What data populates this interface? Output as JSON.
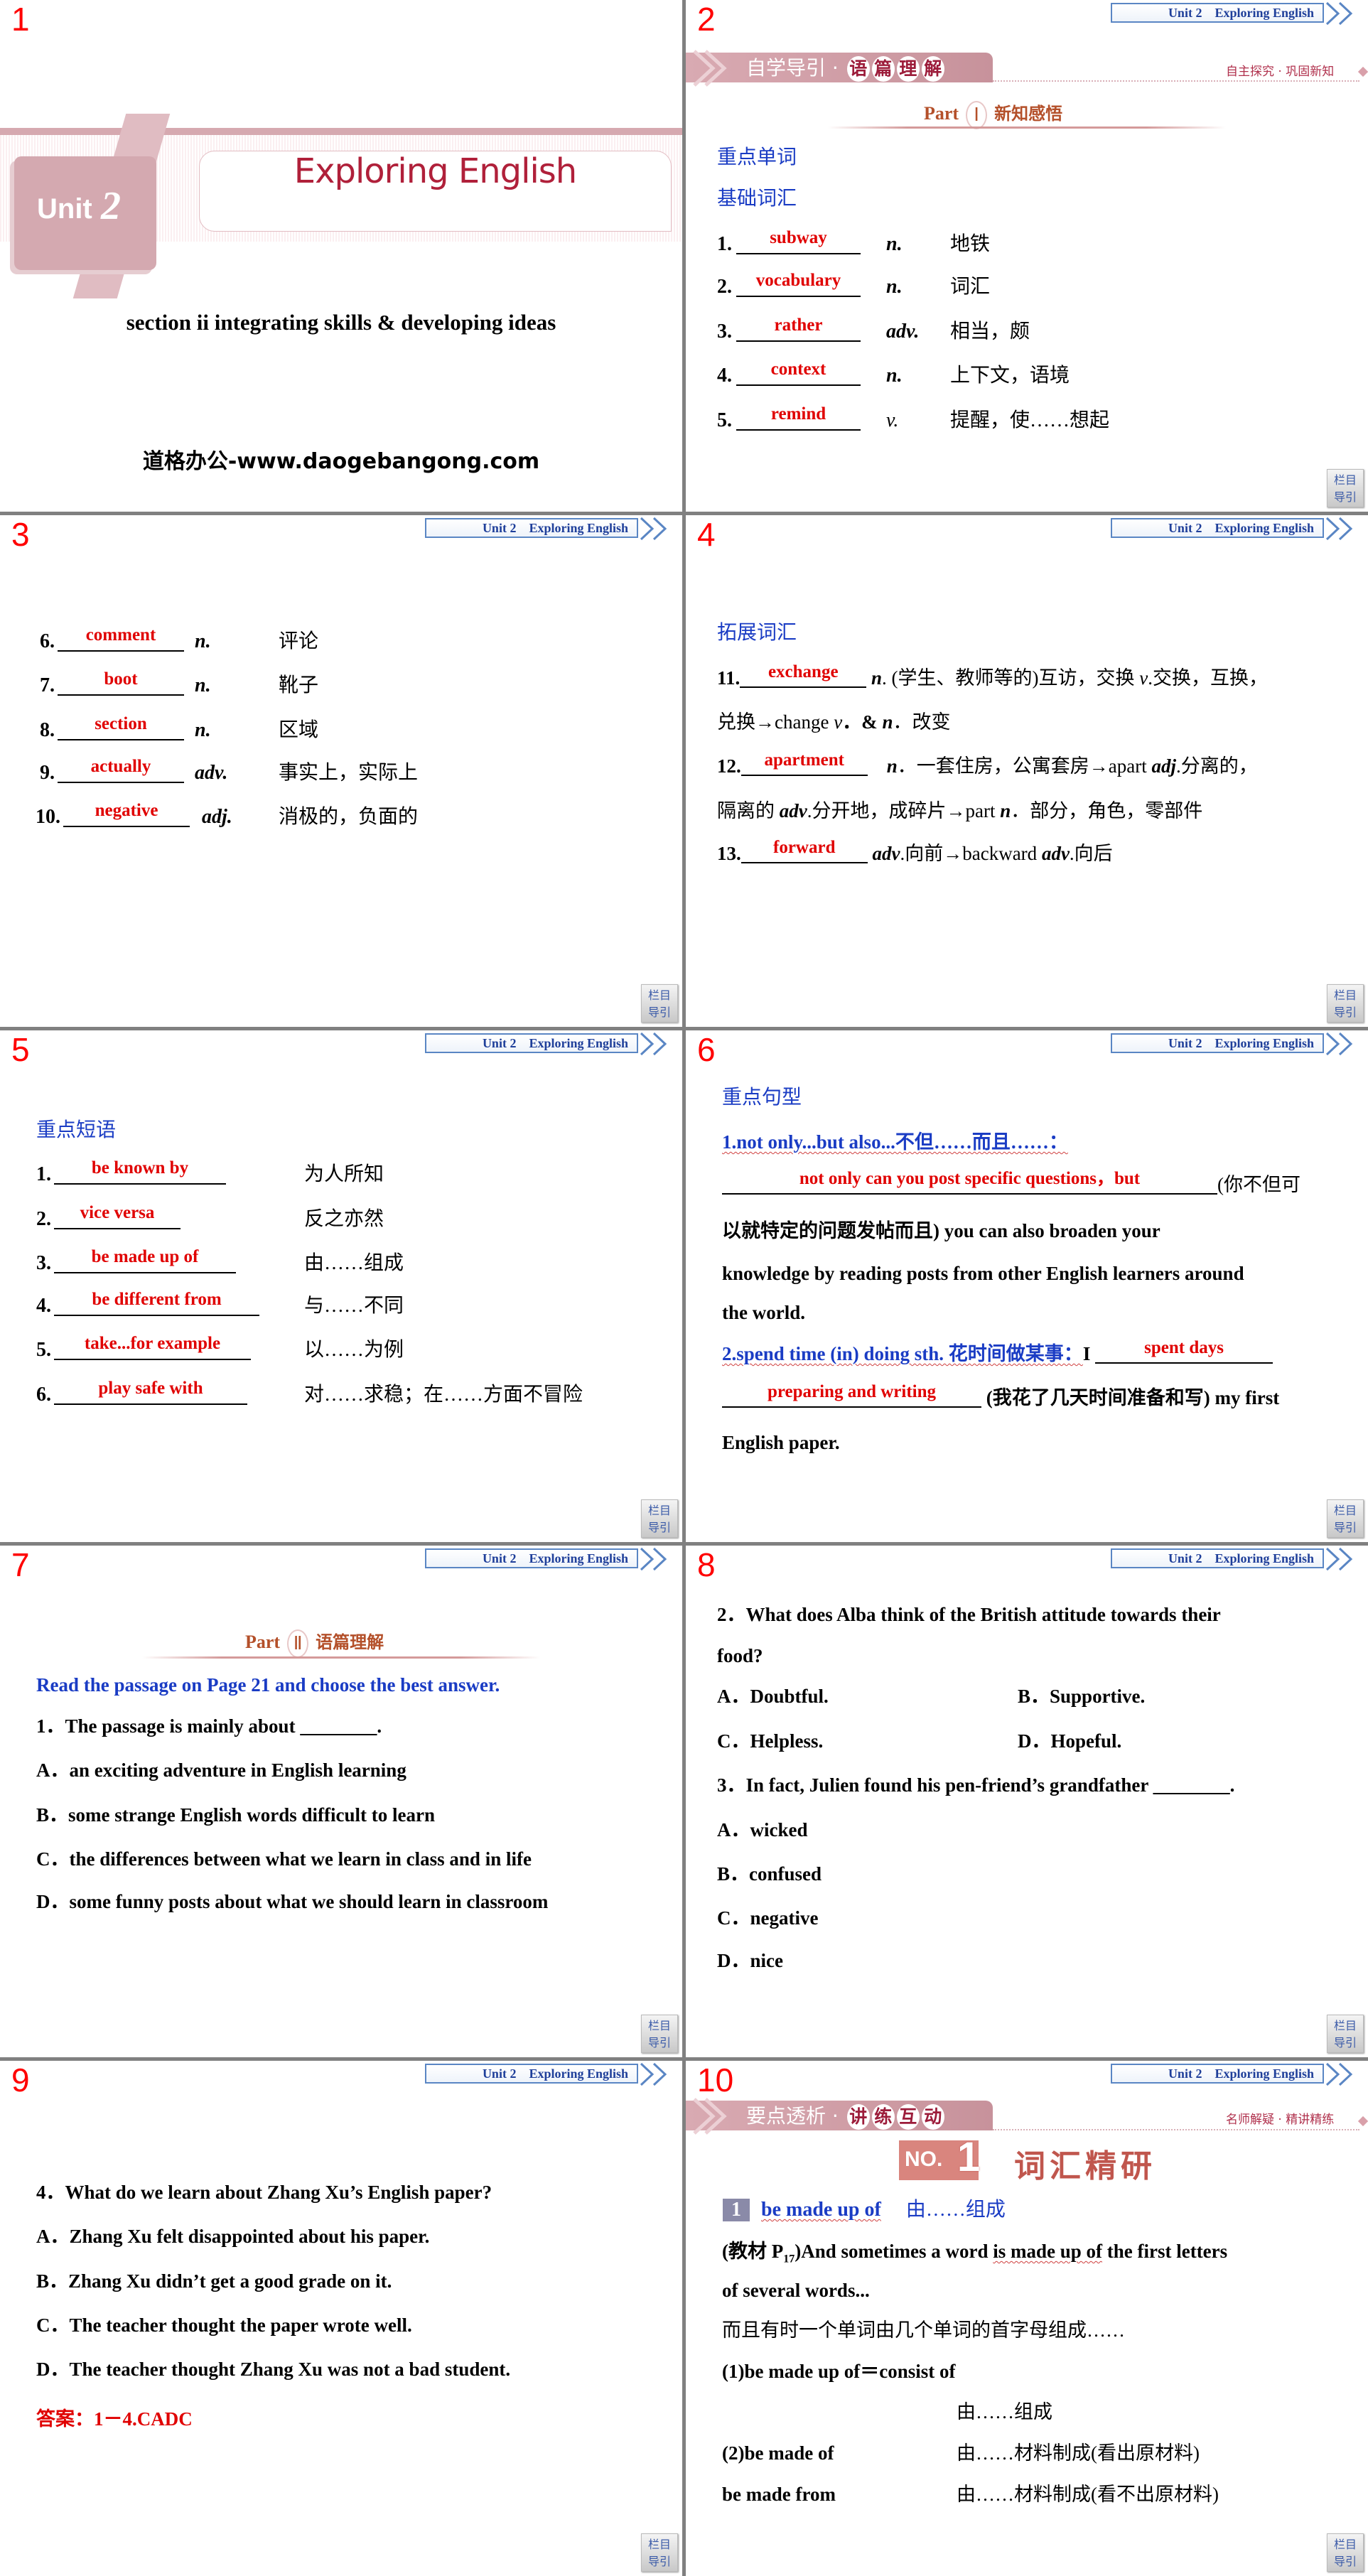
{
  "common": {
    "header": "Unit 2　Exploring English",
    "nav_line1": "栏目",
    "nav_line2": "导引"
  },
  "s1": {
    "number": "1",
    "unit_label": "Unit",
    "unit_num": "2",
    "title": "Exploring English",
    "subtitle": "section ii integrating skills & developing ideas",
    "website": "道格办公-www.daogebangong.com"
  },
  "s2": {
    "number": "2",
    "band_left": "自学导引 ·",
    "band_chars": [
      "语",
      "篇",
      "理",
      "解"
    ],
    "band_tag": "自主探究 · 巩固新知",
    "part_label": "Part",
    "part_num": "Ⅰ",
    "part_title": "新知感悟",
    "heading1": "重点单词",
    "heading2": "基础词汇",
    "items": [
      {
        "n": "1.",
        "ans": "subway",
        "pos": "n.",
        "cn": "地铁"
      },
      {
        "n": "2.",
        "ans": "vocabulary",
        "pos": "n.",
        "cn": "词汇"
      },
      {
        "n": "3.",
        "ans": "rather",
        "pos": "adv.",
        "cn": "相当，颇"
      },
      {
        "n": "4.",
        "ans": "context",
        "pos": "n.",
        "cn": "上下文，语境"
      },
      {
        "n": "5.",
        "ans": "remind",
        "pos": "v.",
        "cn": "提醒，使……想起"
      }
    ]
  },
  "s3": {
    "number": "3",
    "items": [
      {
        "n": "6.",
        "ans": "comment",
        "pos": "n.",
        "cn": "评论"
      },
      {
        "n": "7.",
        "ans": "boot",
        "pos": "n.",
        "cn": "靴子"
      },
      {
        "n": "8.",
        "ans": "section",
        "pos": "n.",
        "cn": "区域"
      },
      {
        "n": "9.",
        "ans": "actually",
        "pos": "adv.",
        "cn": "事实上，实际上"
      },
      {
        "n": "10.",
        "ans": "negative",
        "pos": "adj.",
        "cn": "消极的，负面的"
      }
    ]
  },
  "s4": {
    "number": "4",
    "heading": "拓展词汇",
    "i11": {
      "n": "11.",
      "ans": "exchange",
      "a": "n",
      "b": ". (学生、教师等的)互访，交换 ",
      "c": "v",
      "d": ".交换，互换，",
      "l2a": "兑换→change ",
      "l2b": "v",
      "l2c": "．& ",
      "l2d": "n",
      "l2e": "．改变"
    },
    "i12": {
      "n": "12.",
      "ans": "apartment",
      "a": "n",
      "b": "．一套住房，公寓套房→apart ",
      "c": "adj",
      "d": ".分离的，",
      "l2a": "隔离的 ",
      "l2b": "adv",
      "l2c": ".分开地，成碎片→part ",
      "l2d": "n",
      "l2e": "．部分，角色，零部件"
    },
    "i13": {
      "n": "13.",
      "ans": "forward",
      "a": "adv",
      "b": ".向前→backward ",
      "c": "adv",
      "d": ".向后"
    }
  },
  "s5": {
    "number": "5",
    "heading": "重点短语",
    "items": [
      {
        "n": "1.",
        "ans": "be known by",
        "cn": "为人所知"
      },
      {
        "n": "2.",
        "ans": "vice versa",
        "cn": "反之亦然"
      },
      {
        "n": "3.",
        "ans": "be made up of",
        "cn": "由……组成"
      },
      {
        "n": "4.",
        "ans": "be different from",
        "cn": "与……不同"
      },
      {
        "n": "5.",
        "ans": "take...for example",
        "cn": "以……为例"
      },
      {
        "n": "6.",
        "ans": "play safe with",
        "cn": "对……求稳；在……方面不冒险"
      }
    ]
  },
  "s6": {
    "number": "6",
    "heading": "重点句型",
    "p1_title": "1.not only...but also...不但……而且……：",
    "p1_ans": "not only can you post specific questions，but",
    "p1_a": "(你不但可",
    "p1_b": "以就特定的问题发帖而且) you can also broaden your",
    "p1_c": "knowledge by reading posts from other English learners around",
    "p1_d": "the world.",
    "p2_title": "2.spend time (in) doing sth. 花时间做某事：",
    "p2_i": "I ",
    "p2_ans1": "spent days",
    "p2_ans2": "preparing and writing",
    "p2_a": "(我花了几天时间准备和写) my first",
    "p2_b": "English paper."
  },
  "s7": {
    "number": "7",
    "part_label": "Part",
    "part_num": "Ⅱ",
    "part_title": "语篇理解",
    "instruction": "Read the passage on Page 21 and choose the best answer.",
    "question": "1．The passage is mainly about ________.",
    "options": [
      "A．an exciting adventure in English learning",
      "B．some strange English words difficult to learn",
      "C．the differences between what we learn in class and in life",
      "D．some funny posts about what we should learn in classroom"
    ]
  },
  "s8": {
    "number": "8",
    "q2": "2．What does Alba think of the British attitude towards their",
    "q2b": "food?",
    "q2_options": [
      "A．Doubtful.",
      "B．Supportive.",
      "C．Helpless.",
      "D．Hopeful."
    ],
    "q3": "3．In fact, Julien found his pen-friend’s grandfather ________.",
    "q3_options": [
      "A．wicked",
      "B．confused",
      "C．negative",
      "D．nice"
    ]
  },
  "s9": {
    "number": "9",
    "q4": "4．What do we learn about Zhang Xu’s English paper?",
    "options": [
      "A．Zhang Xu felt disappointed about his paper.",
      "B．Zhang Xu didn’t get a good grade on it.",
      "C．The teacher thought the paper wrote well.",
      "D．The teacher thought Zhang Xu was not a bad student."
    ],
    "answer": "答案：1－4.CADC"
  },
  "s10": {
    "number": "10",
    "band_left": "要点透析 ·",
    "band_chars": [
      "讲",
      "练",
      "互",
      "动"
    ],
    "band_tag": "名师解疑 · 精讲精练",
    "no_label": "NO.",
    "no_num": "1",
    "title": "词汇精研",
    "item_num": "1",
    "phrase": "be made up of",
    "phrase_cn": "由……组成",
    "ex_a": "(教材 P",
    "ex_sub": "17",
    "ex_b": ")And sometimes a word ",
    "ex_u": "is made up of",
    "ex_c": " the first letters",
    "ex_d": "of several words...",
    "ex_cn": "而且有时一个单词由几个单词的首字母组成……",
    "l1": "(1)be made up of＝consist of",
    "l1_cn": "由……组成",
    "l2": "(2)be made of",
    "l2_cn": "由……材料制成(看出原材料)",
    "l3": "be made from",
    "l3_cn": "由……材料制成(看不出原材料)"
  },
  "colors": {
    "slide_number": "#ff0000",
    "heading_blue": "#1a3cc4",
    "answer_red": "#e00000",
    "band_pink": "#c7929b",
    "title_red": "#b0203a",
    "part_brown": "#b4502a"
  }
}
